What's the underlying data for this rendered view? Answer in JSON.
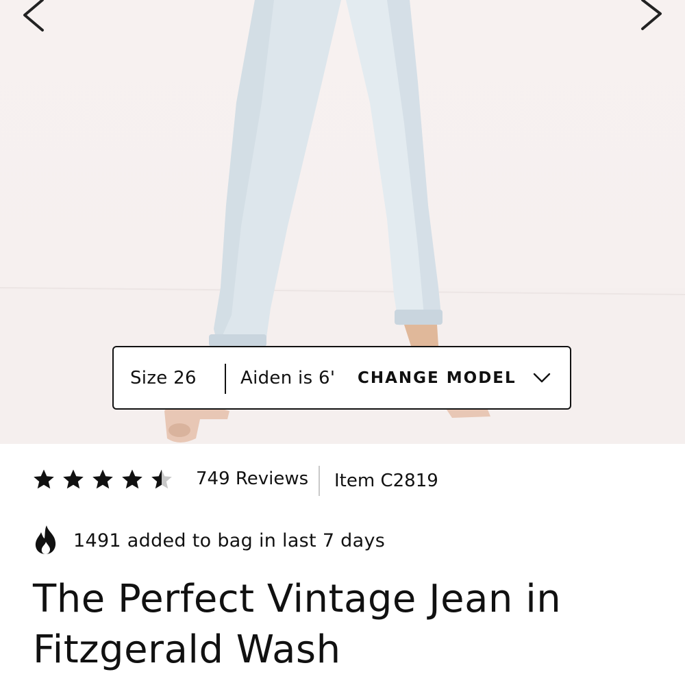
{
  "model_info": {
    "size": "Size 26",
    "model_height": "Aiden is 6'",
    "change_model_label": "CHANGE MODEL"
  },
  "rating": {
    "value": 4.5,
    "max": 5,
    "reviews_label": "749 Reviews",
    "item_number": "Item C2819"
  },
  "popularity": {
    "text": "1491 added to bag in last 7 days"
  },
  "product": {
    "title": "The Perfect Vintage Jean in Fitzgerald Wash"
  },
  "colors": {
    "star_filled": "#111111",
    "star_empty": "#c8c8c8",
    "text": "#111111",
    "divider": "#c9c9c9",
    "denim": "#dbe4ea"
  },
  "icons": {
    "prev": "chevron-left-icon",
    "next": "chevron-right-icon",
    "dropdown": "chevron-down-icon",
    "popularity": "flame-icon",
    "rating": "star-icon"
  }
}
